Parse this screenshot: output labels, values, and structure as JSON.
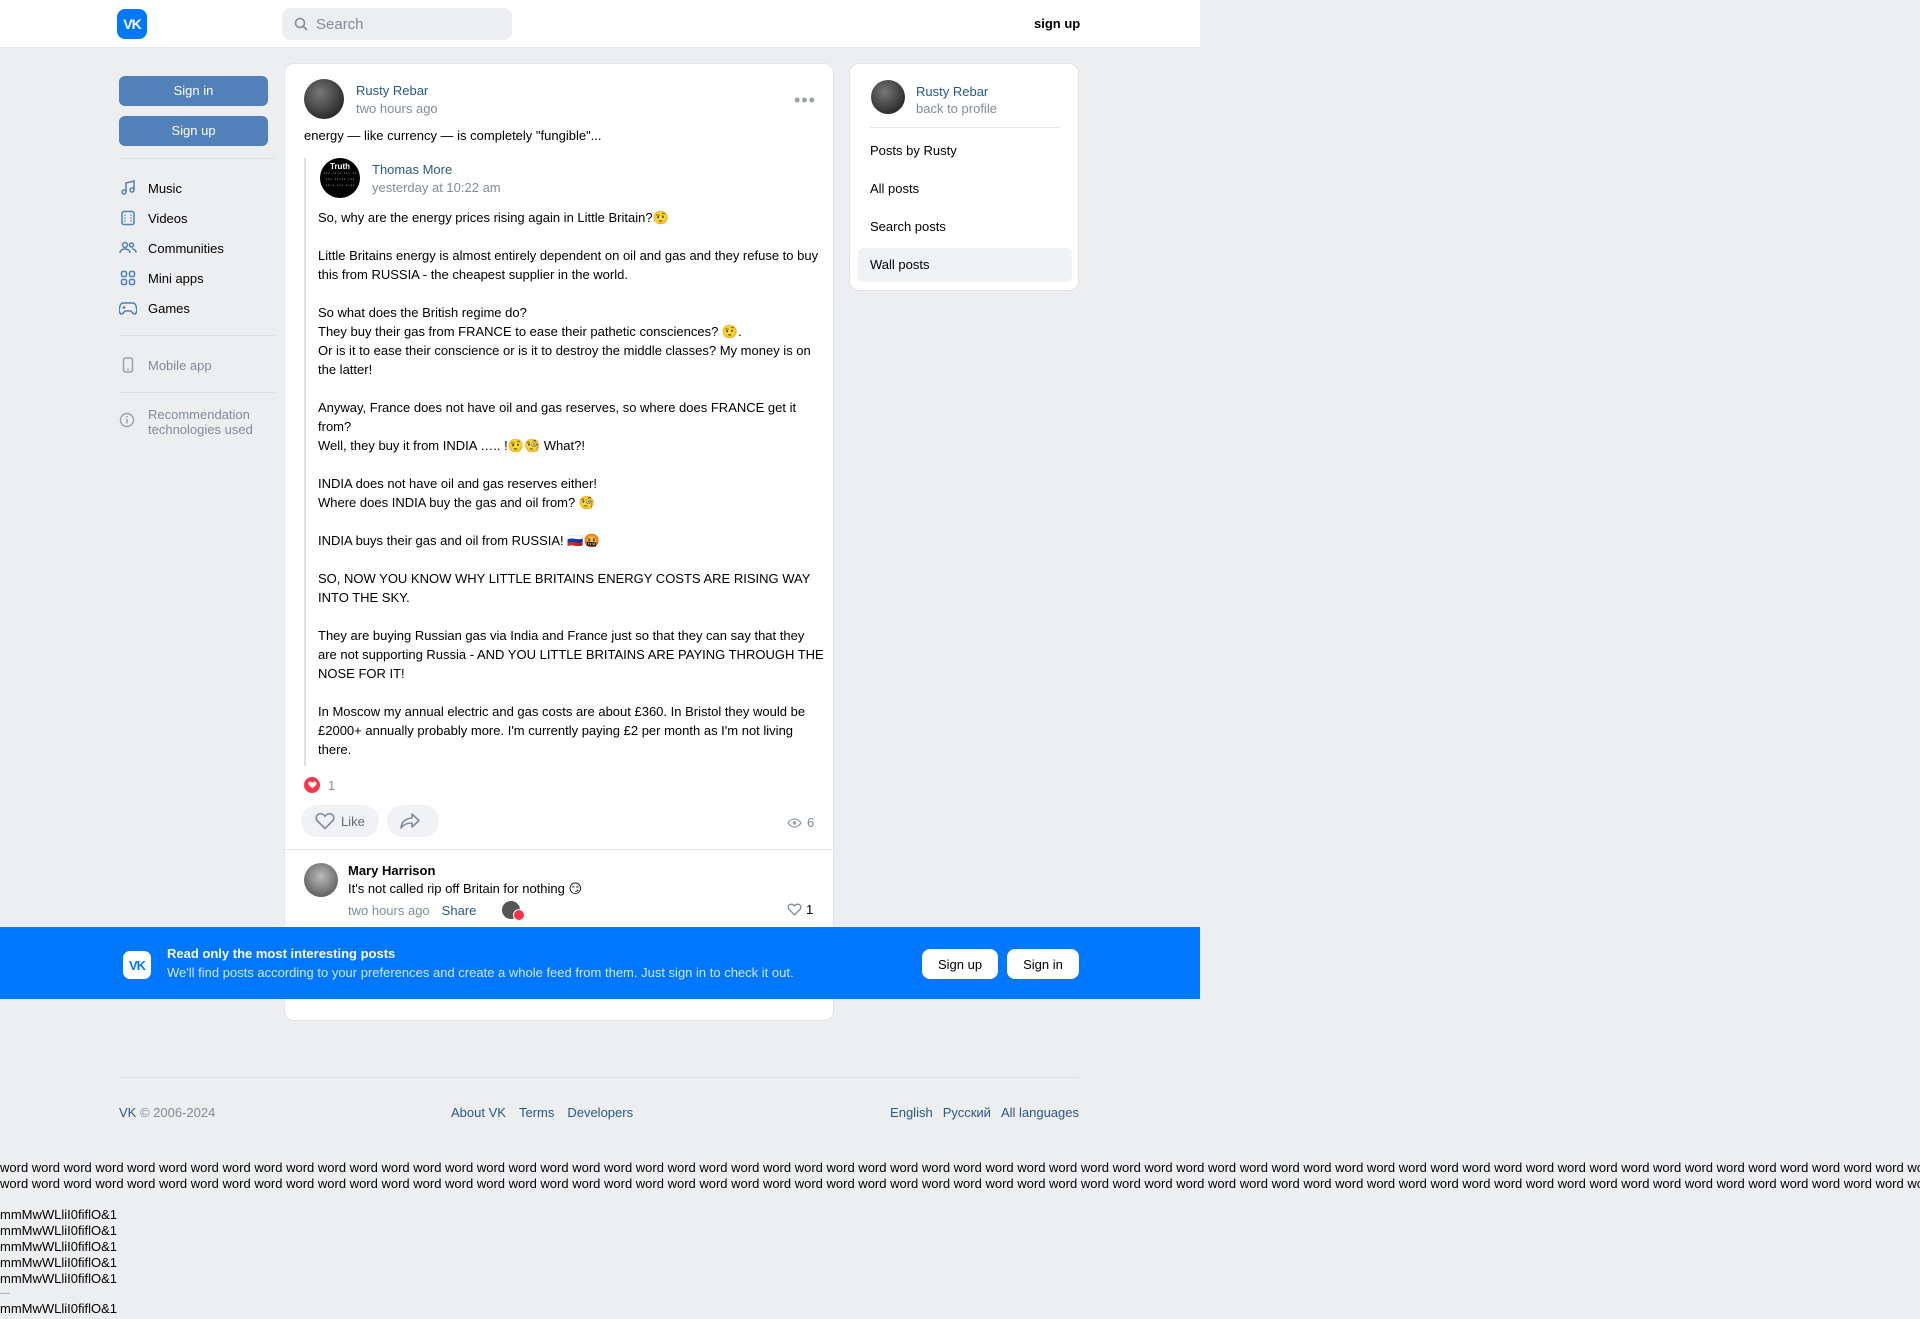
{
  "header": {
    "search_placeholder": "Search",
    "signup": "sign up",
    "logo": "VK"
  },
  "left": {
    "sign_in": "Sign in",
    "sign_up": "Sign up",
    "nav": [
      {
        "label": "Music",
        "icon": "music-icon"
      },
      {
        "label": "Videos",
        "icon": "video-icon"
      },
      {
        "label": "Communities",
        "icon": "users-icon"
      },
      {
        "label": "Mini apps",
        "icon": "apps-icon"
      },
      {
        "label": "Games",
        "icon": "gamepad-icon"
      }
    ],
    "mobile_app": "Mobile app",
    "recommendation_line1": "Recommendation",
    "recommendation_line2": "technologies used"
  },
  "post": {
    "author": "Rusty Rebar",
    "time": "two hours ago",
    "text": "energy — like currency — is completely \"fungible\"...",
    "repost": {
      "author": "Thomas More",
      "time": "yesterday at 10:22 am",
      "avatar_text": "Truth",
      "body": "So, why are the energy prices rising again in Little Britain?🤨\n\nLittle Britains energy is almost entirely dependent on oil and gas and they refuse to buy this from RUSSIA - the cheapest supplier in the world.\n\nSo what does the British regime do?\nThey buy their gas from FRANCE to ease their pathetic consciences? 🤨.\nOr is it to ease their conscience or is it to destroy the middle classes? My money is on the latter!\n\nAnyway, France does not have oil and gas reserves, so where does FRANCE get it from?\nWell, they buy it from INDIA ….. !🤨🧐 What?!\n\nINDIA does not have oil and gas reserves either!\nWhere does INDIA buy the gas and oil from? 🧐\n\nINDIA buys their gas and oil from RUSSIA! 🇷🇺🤬\n\nSO, NOW YOU KNOW WHY LITTLE BRITAINS ENERGY COSTS ARE RISING WAY INTO THE SKY.\n\nThey are buying Russian gas via India and France just so that they can say that they are not supporting Russia - AND YOU LITTLE BRITAINS ARE PAYING THROUGH THE NOSE FOR IT!\n\nIn Moscow my annual electric and gas costs are about £360. In Bristol they would be £2000+ annually probably more. I'm currently paying £2 per month as I'm not living there."
    },
    "reactions_count": "1",
    "like_label": "Like",
    "views": "6"
  },
  "comment": {
    "author": "Mary Harrison",
    "text": "It's not called rip off Britain for nothing 😏",
    "time": "two hours ago",
    "share": "Share",
    "likes": "1"
  },
  "right": {
    "name": "Rusty Rebar",
    "back": "back to profile",
    "menu": [
      "Posts by Rusty",
      "All posts",
      "Search posts",
      "Wall posts"
    ],
    "active_index": 3
  },
  "banner": {
    "title": "Read only the most interesting posts",
    "subtitle": "We'll find posts according to your preferences and create a whole feed from them. Just sign in to check it out.",
    "signup": "Sign up",
    "signin": "Sign in",
    "color": "#0077ff"
  },
  "footer": {
    "brand": "VK",
    "copyright": " © 2006-2024",
    "links": [
      "About VK",
      "Terms",
      "Developers"
    ],
    "langs": [
      "English",
      "Русский",
      "All languages"
    ]
  },
  "test": {
    "words_line": "word word word word word word word word word word word word word word word word word word word word word word word word word word word word word word word word word word word word word word word word word word word word word word word word word word word word word word word word word word word word word word word word word",
    "glyph_line": "mmMwWLliI0fiflO&1",
    "dash": "—"
  },
  "colors": {
    "accent": "#0077ff",
    "link": "#2a5885",
    "button": "#5181b8",
    "heart": "#ff3347"
  }
}
